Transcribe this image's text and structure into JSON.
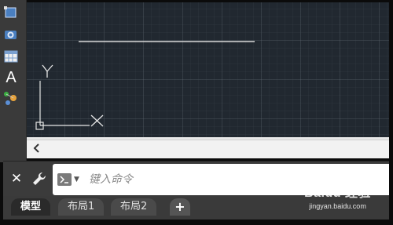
{
  "canvas": {
    "ucs_y_label": "Y",
    "ucs_x_label": "X"
  },
  "toolbar": {
    "text_tool_label": "A",
    "icons": [
      "rectangle-select-icon",
      "camera-icon",
      "table-icon",
      "text-icon",
      "block-icon"
    ]
  },
  "command": {
    "close_label": "✕",
    "placeholder": "键入命令"
  },
  "tabs": [
    {
      "label": "模型",
      "active": true
    },
    {
      "label": "布局1",
      "active": false
    },
    {
      "label": "布局2",
      "active": false
    }
  ],
  "add_tab_label": "+",
  "watermark": {
    "main": "Baidu 经验",
    "sub": "jingyan.baidu.com"
  },
  "colors": {
    "canvas_bg": "#212830",
    "toolbar_bg": "#3a3a3a",
    "line": "#d8d8d8"
  }
}
